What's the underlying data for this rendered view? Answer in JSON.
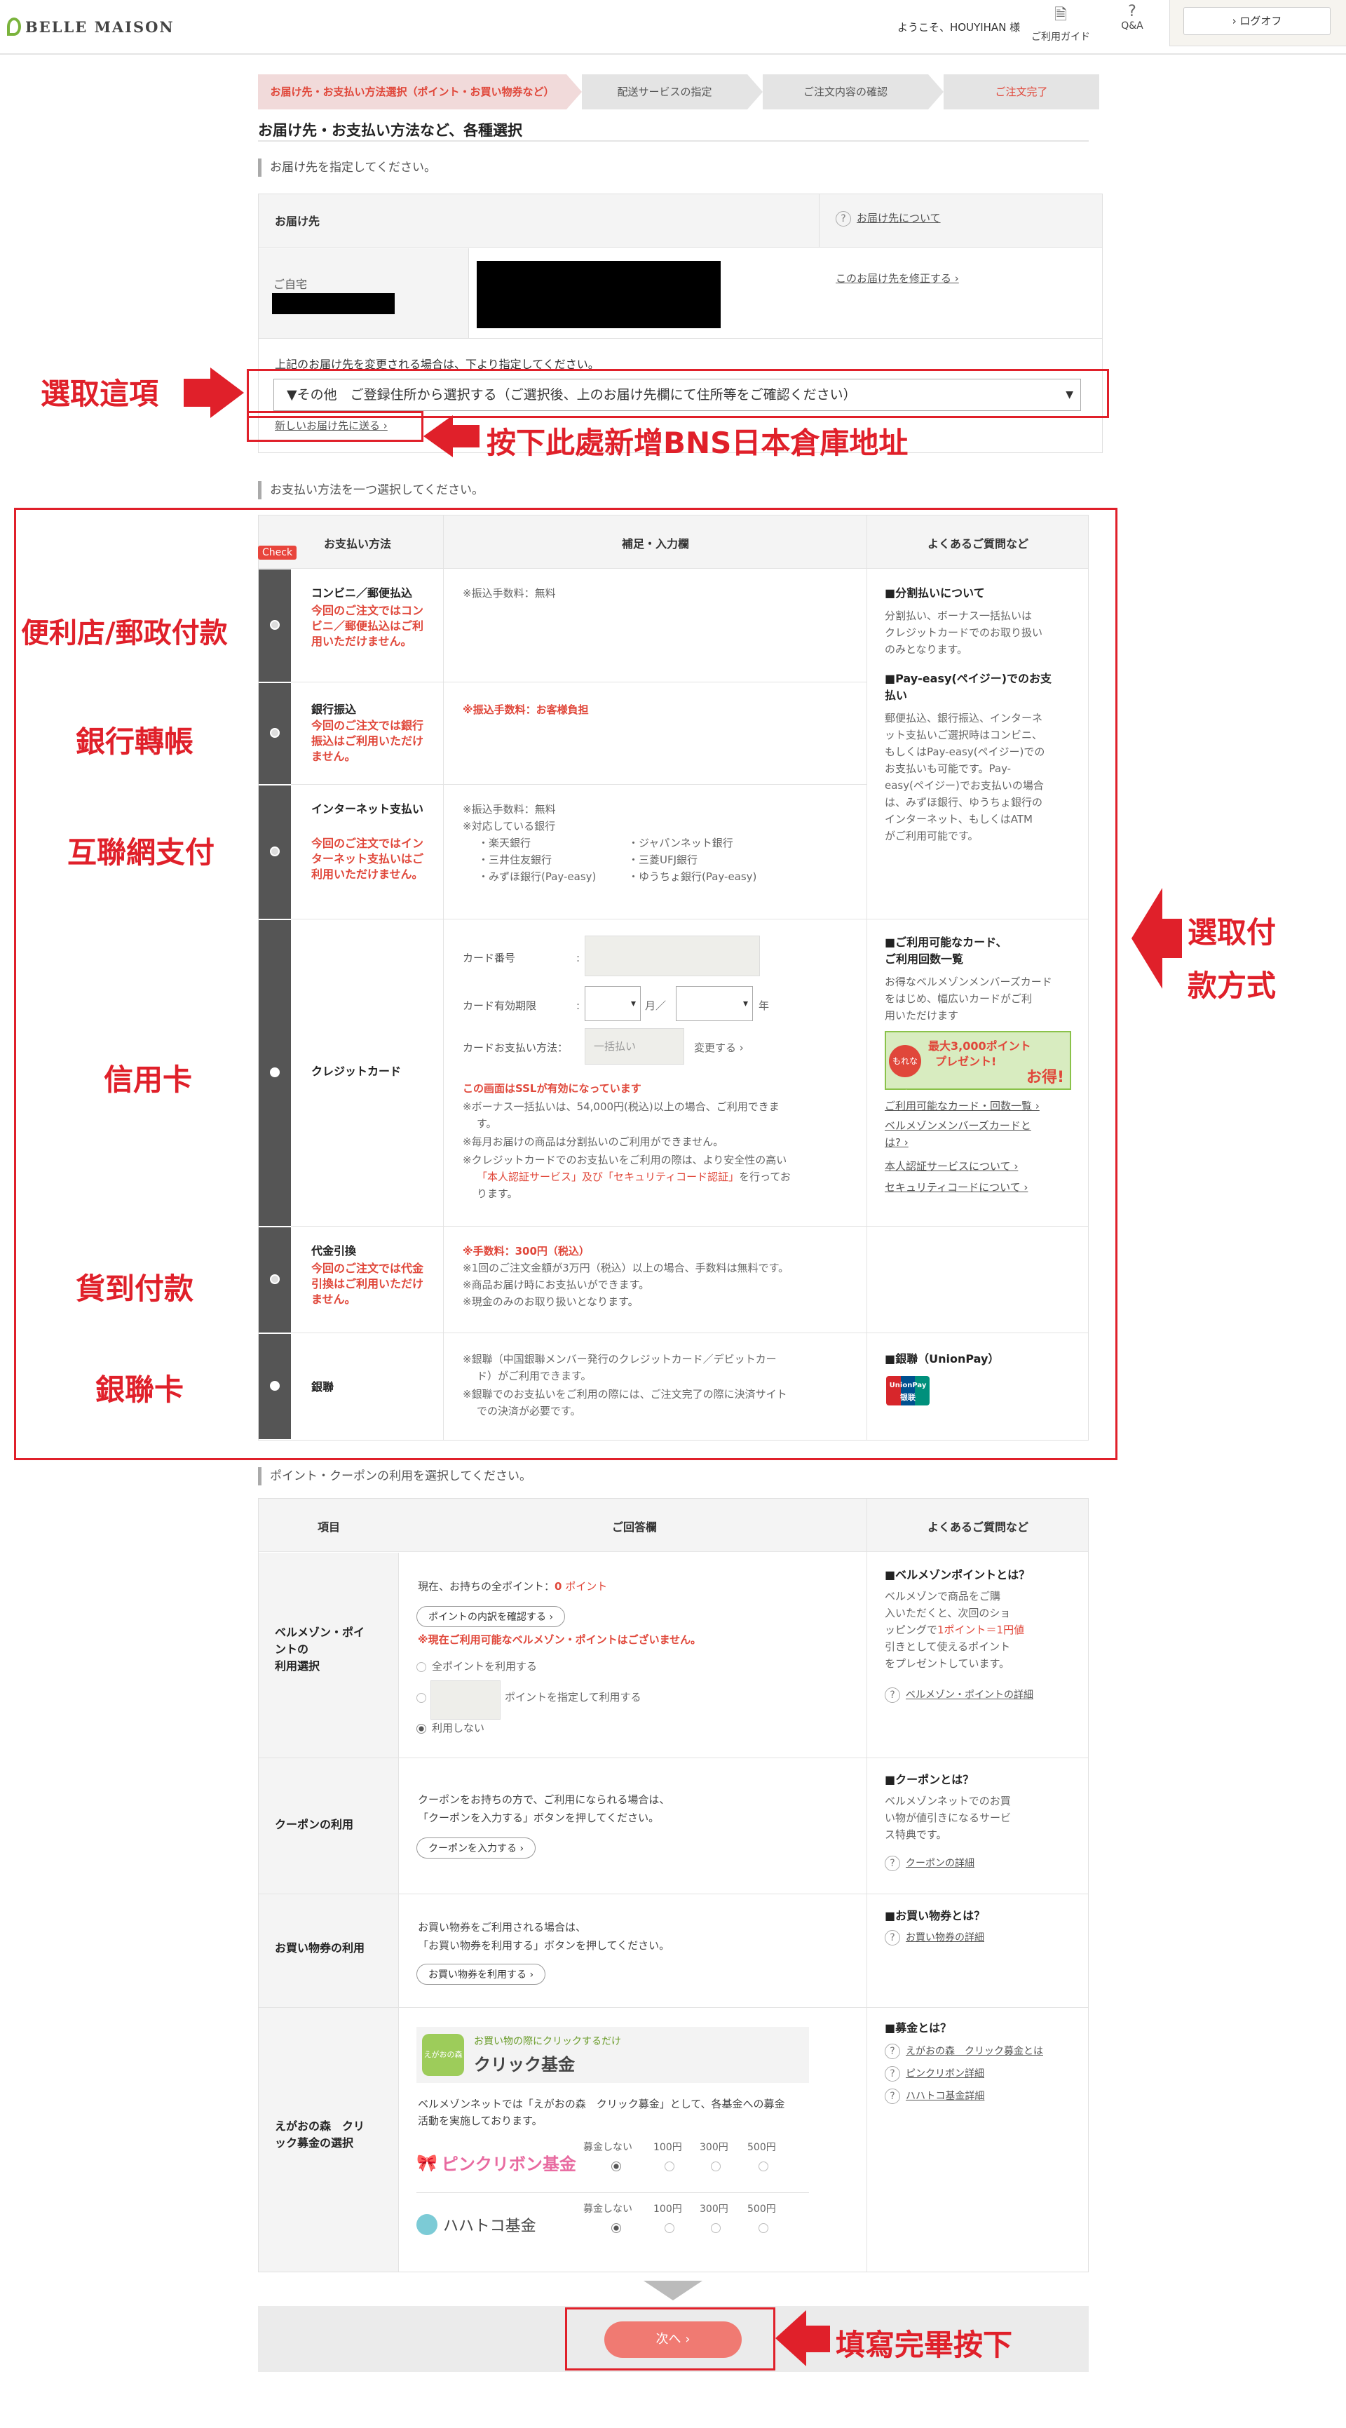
{
  "header": {
    "brand": "BELLE MAISON",
    "welcome": "ようこそ、HOUYIHAN 様",
    "guide": "ご利用ガイド",
    "qa": "Q&A",
    "logout": "› ログオフ"
  },
  "steps": [
    "お届け先・お支払い方法選択（ポイント・お買い物券など）",
    "配送サービスの指定",
    "ご注文内容の確認",
    "ご注文完了"
  ],
  "page_title": "お届け先・お支払い方法など、各種選択",
  "address": {
    "section": "お届け先を指定してください。",
    "col_label": "お届け先",
    "help_link": "お届け先について",
    "home_label": "ご自宅",
    "edit_link": "このお届け先を修正する ›",
    "change_note": "上記のお届け先を変更される場合は、下より指定してください。",
    "select_value": "▼その他　ご登録住所から選択する（ご選択後、上のお届け先欄にて住所等をご確認ください）",
    "new_link": "新しいお届け先に送る ›"
  },
  "payment": {
    "section": "お支払い方法を一つ選択してください。",
    "check_tag": "Check",
    "headers": [
      "お支払い方法",
      "補足・入力欄",
      "よくあるご質問など"
    ],
    "methods": [
      {
        "name": "コンビニ／郵便払込",
        "warn": "今回のご注文ではコンビニ／郵便払込はご利用いただけません。",
        "note1": "※振込手数料：無料"
      },
      {
        "name": "銀行振込",
        "warn": "今回のご注文では銀行振込はご利用いただけません。",
        "note1": "※振込手数料：お客様負担"
      },
      {
        "name": "インターネット支払い",
        "warn": "今回のご注文ではインターネット支払いはご利用いただけません。",
        "note1": "※振込手数料：無料",
        "note2": "※対応している銀行",
        "banks": [
          "・楽天銀行",
          "・ジャパンネット銀行",
          "・三井住友銀行",
          "・三菱UFJ銀行",
          "・みずほ銀行(Pay-easy)",
          "・ゆうちょ銀行(Pay-easy)"
        ]
      },
      {
        "name": "クレジットカード"
      },
      {
        "name": "代金引換",
        "warn": "今回のご注文では代金引換はご利用いただけません。",
        "note1": "※手数料：300円（税込）",
        "note2": "※1回のご注文金額が3万円（税込）以上の場合、手数料は無料です。",
        "note3": "※商品お届け時にお支払いができます。",
        "note4": "※現金のみのお取り扱いとなります。"
      },
      {
        "name": "銀聯",
        "note1": "※銀聯（中国銀聯メンバー発行のクレジットカード／デビットカー",
        "note1b": "ド）がご利用できます。",
        "note2": "※銀聯でのお支払いをご利用の際には、ご注文完了の際に決済サイト",
        "note2b": "での決済が必要です。"
      }
    ],
    "card": {
      "number": "カード番号",
      "expiry": "カード有効期限",
      "month": "月／",
      "year": "年",
      "paymode": "カードお支払い方法：",
      "paymode_val": "一括払い",
      "change": "変更する ›",
      "ssl": "この画面はSSLが有効になっています",
      "n1": "※ボーナス一括払いは、54,000円(税込)以上の場合、ご利用できま",
      "n1b": "す。",
      "n2": "※毎月お届けの商品は分割払いのご利用ができません。",
      "n3": "※クレジットカードでのお支払いをご利用の際は、より安全性の高い",
      "n3b": "「本人認証サービス」及び「セキュリティコード認証」",
      "n3c": "を行ってお",
      "n3d": "ります。"
    },
    "faq": {
      "split_h": "■分割払いについて",
      "split_t": [
        "分割払い、ボーナス一括払いは",
        "クレジットカードでのお取り扱い",
        "のみとなります。"
      ],
      "payeasy_h": [
        "■Pay-easy(ペイジー)でのお支",
        "払い"
      ],
      "payeasy_t": [
        "郵便払込、銀行振込、インターネ",
        "ット支払いご選択時はコンビニ、",
        "もしくはPay-easy(ペイジー)での",
        "お支払いも可能です。Pay-",
        "easy(ペイジー)でお支払いの場合",
        "は、みずほ銀行、ゆうちょ銀行の",
        "インターネット、もしくはATM",
        "がご利用可能です。"
      ],
      "cards_h": [
        "■ご利用可能なカード、",
        "ご利用回数一覧"
      ],
      "cards_t": [
        "お得なベルメゾンメンバーズカード",
        "をはじめ、幅広いカードがご利",
        "用いただけます"
      ],
      "promo_1": "最大3,000ポイント",
      "promo_2": "プレゼント!",
      "promo_3": "お得!",
      "promo_tag": "もれなく",
      "links": [
        "ご利用可能なカード・回数一覧 ›",
        "ベルメゾンメンバーズカードと",
        "は? ›",
        "本人認証サービスについて ›",
        "セキュリティコードについて ›"
      ],
      "union_h": "■銀聯（UnionPay）",
      "union_logo": "UnionPay",
      "union_logo2": "银联"
    }
  },
  "points": {
    "section": "ポイント・クーポンの利用を選択してください。",
    "headers": [
      "項目",
      "ご回答欄",
      "よくあるご質問など"
    ],
    "rows": [
      {
        "label": [
          "ベルメゾン・ポイ",
          "ントの",
          "利用選択"
        ],
        "l1": "現在、お持ちの全ポイント：",
        "l1v": "0",
        "l1u": "ポイント",
        "btn": "ポイントの内訳を確認する ›",
        "warn": "※現在ご利用可能なベルメゾン・ポイントはございません。",
        "r1": "全ポイントを利用する",
        "r2": "ポイントを指定して利用する",
        "r3": "利用しない",
        "faq_h": "■ベルメゾンポイントとは？",
        "faq_t": [
          "ベルメゾンで商品をご購",
          "入いただくと、次回のショ",
          "ッピングで"
        ],
        "faq_red": [
          "1ポイント＝1円値",
          "引きとして使えるポイント"
        ],
        "faq_t2": "をプレゼントしています。",
        "faq_link": "ベルメゾン・ポイントの詳細"
      },
      {
        "label": [
          "クーポンの利用"
        ],
        "l1": "クーポンをお持ちの方で、ご利用になられる場合は、",
        "l2": "「クーポンを入力する」ボタンを押してください。",
        "btn": "クーポンを入力する ›",
        "faq_h": "■クーポンとは？",
        "faq_t": [
          "ベルメゾンネットでのお買",
          "い物が値引きになるサービ",
          "ス特典です。"
        ],
        "faq_link": "クーポンの詳細"
      },
      {
        "label": [
          "お買い物券の利用"
        ],
        "l1": "お買い物券をご利用される場合は、",
        "l2": "「お買い物券を利用する」ボタンを押してください。",
        "btn": "お買い物券を利用する ›",
        "faq_h": "■お買い物券とは？",
        "faq_link": "お買い物券の詳細"
      },
      {
        "label": [
          "えがおの森　クリ",
          "ック募金の選択"
        ],
        "banner_top": "お買い物の際にクリックするだけ",
        "banner_main": "クリック基金",
        "banner_icon": "えがおの森",
        "desc1": "ベルメゾンネットでは「えがおの森　クリック募金」として、各基金への募金",
        "desc2": "活動を実施しております。",
        "funds": [
          {
            "name": "ピンクリボン基金",
            "opts": [
              "募金しない",
              "100円",
              "300円",
              "500円"
            ]
          },
          {
            "name": "ハハトコ基金",
            "opts": [
              "募金しない",
              "100円",
              "300円",
              "500円"
            ]
          }
        ],
        "faq_h": "■募金とは？",
        "faq_links": [
          "えがおの森　クリック募金とは",
          "ピンクリボン詳細",
          "ハハトコ基金詳細"
        ]
      }
    ]
  },
  "next_button": "次へ ›",
  "annotations": {
    "select_this": "選取這項",
    "new_address": "按下此處新增BNS日本倉庫地址",
    "convenience": "便利店/郵政付款",
    "bank": "銀行轉帳",
    "internet": "互聯網支付",
    "credit": "信用卡",
    "cod": "貨到付款",
    "unionpay": "銀聯卡",
    "choose_pay_1": "選取付",
    "choose_pay_2": "款方式",
    "done": "填寫完畢按下"
  },
  "colors": {
    "accent_red": "#e0202a",
    "brand_green": "#7ab33c",
    "next_btn": "#f07a72",
    "warn": "#e0473a"
  }
}
